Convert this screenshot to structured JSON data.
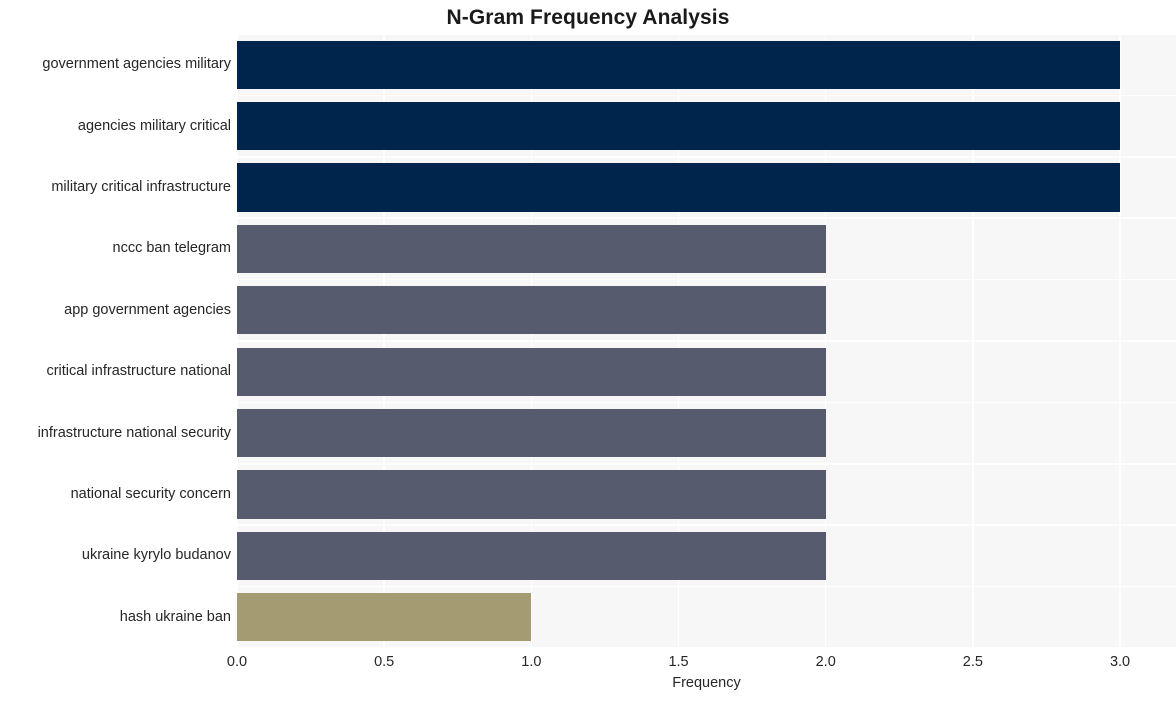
{
  "chart_data": {
    "type": "bar",
    "orientation": "horizontal",
    "title": "N-Gram Frequency Analysis",
    "xlabel": "Frequency",
    "ylabel": "",
    "xlim": [
      0.0,
      3.19
    ],
    "ylim": [
      0,
      10
    ],
    "grid": true,
    "legend": null,
    "x_ticks": [
      "0.0",
      "0.5",
      "1.0",
      "1.5",
      "2.0",
      "2.5",
      "3.0"
    ],
    "x_tick_values": [
      0.0,
      0.5,
      1.0,
      1.5,
      2.0,
      2.5,
      3.0
    ],
    "categories": [
      "government agencies military",
      "agencies military critical",
      "military critical infrastructure",
      "nccc ban telegram",
      "app government agencies",
      "critical infrastructure national",
      "infrastructure national security",
      "national security concern",
      "ukraine kyrylo budanov",
      "hash ukraine ban"
    ],
    "values": [
      3,
      3,
      3,
      2,
      2,
      2,
      2,
      2,
      2,
      1
    ],
    "bar_colors": [
      "#00254d",
      "#00254d",
      "#00254d",
      "#565b6e",
      "#565b6e",
      "#565b6e",
      "#565b6e",
      "#565b6e",
      "#565b6e",
      "#a59b72"
    ]
  },
  "style": {
    "plot_background": "#f7f7f8",
    "figure_background": "#ffffff",
    "gridline_color": "#ffffff",
    "text_color": "#262626",
    "title_color": "#1a1a1a"
  }
}
